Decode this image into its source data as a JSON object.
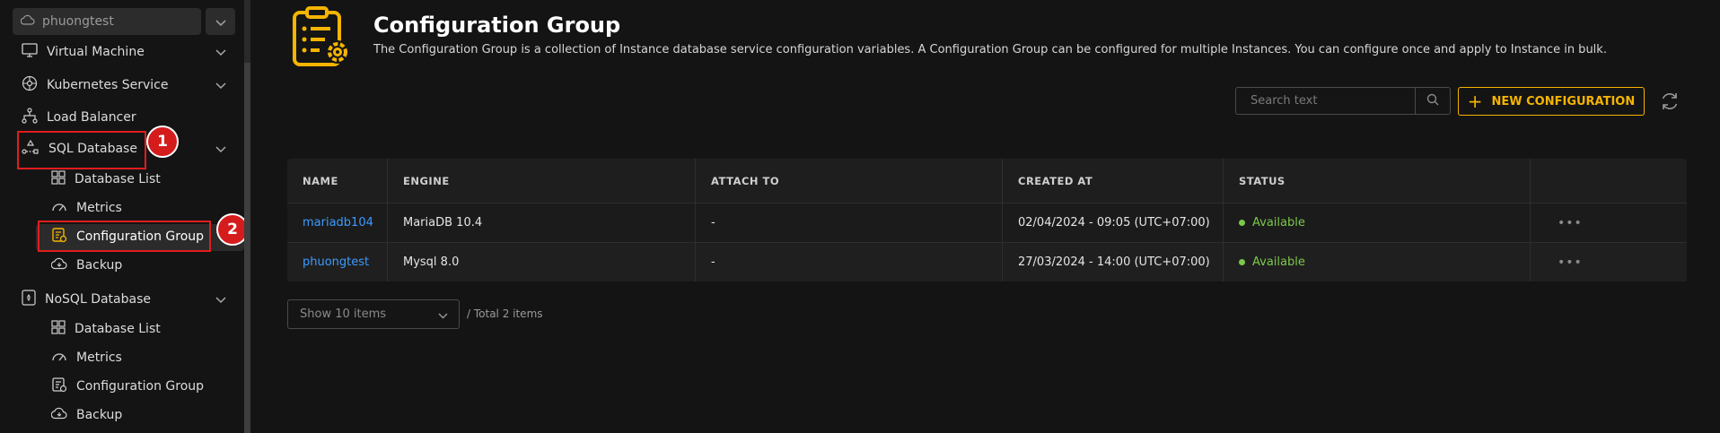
{
  "sidebar": {
    "project": "phuongtest",
    "items": [
      {
        "label": "Virtual Machine"
      },
      {
        "label": "Kubernetes Service"
      },
      {
        "label": "Load Balancer"
      },
      {
        "label": "SQL Database"
      },
      {
        "label": "NoSQL Database"
      }
    ],
    "sql_sub": [
      {
        "label": "Database List"
      },
      {
        "label": "Metrics"
      },
      {
        "label": "Configuration Group"
      },
      {
        "label": "Backup"
      }
    ],
    "nosql_sub": [
      {
        "label": "Database List"
      },
      {
        "label": "Metrics"
      },
      {
        "label": "Configuration Group"
      },
      {
        "label": "Backup"
      }
    ],
    "annotations": [
      "1",
      "2"
    ]
  },
  "header": {
    "title": "Configuration Group",
    "description": "The Configuration Group is a collection of Instance database service configuration variables. A Configuration Group can be configured for multiple Instances. You can configure once and apply to Instance in bulk."
  },
  "toolbar": {
    "search_placeholder": "Search text",
    "new_button": "NEW CONFIGURATION"
  },
  "table": {
    "columns": [
      "NAME",
      "ENGINE",
      "ATTACH TO",
      "CREATED AT",
      "STATUS"
    ],
    "rows": [
      {
        "name": "mariadb104",
        "engine": "MariaDB 10.4",
        "attach": "-",
        "created": "02/04/2024 - 09:05 (UTC+07:00)",
        "status": "Available"
      },
      {
        "name": "phuongtest",
        "engine": "Mysql 8.0",
        "attach": "-",
        "created": "27/03/2024 - 14:00 (UTC+07:00)",
        "status": "Available"
      }
    ]
  },
  "pagination": {
    "page_size": "Show 10 items",
    "total": "/ Total 2 items"
  },
  "colors": {
    "accent": "#f5b400",
    "link": "#3d9bff",
    "status_ok": "#7cc84a",
    "highlight": "#e11d1d"
  }
}
